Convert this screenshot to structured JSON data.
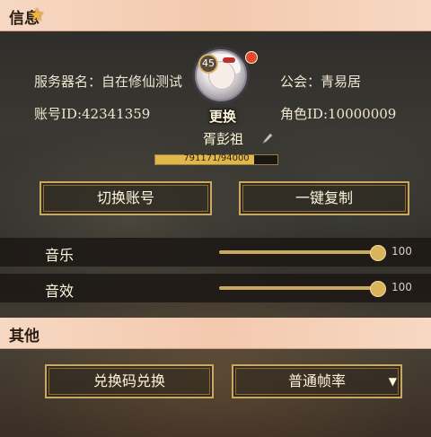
{
  "info_section": {
    "title": "信息"
  },
  "profile": {
    "server_label": "服务器名：自在修仙测试",
    "guild_label": "公会：青易居",
    "account_id_label": "账号ID:42341359",
    "role_id_label": "角色ID:10000009",
    "level": "45",
    "change_label": "更换",
    "player_name": "胥彭祖",
    "exp_text": "791171/94000",
    "exp_fraction": 0.81
  },
  "actions": {
    "switch_account": "切换账号",
    "copy_all": "一键复制"
  },
  "audio": {
    "music_label": "音乐",
    "music_value": "100",
    "music_level": 1.0,
    "sfx_label": "音效",
    "sfx_value": "100",
    "sfx_level": 1.0
  },
  "other_section": {
    "title": "其他"
  },
  "other": {
    "redeem_button": "兑换码兑换",
    "framerate_select": "普通帧率"
  },
  "colors": {
    "header_bg": "#f3c9ae",
    "gold": "#c9a85f",
    "red_dot": "#e34a2d"
  }
}
